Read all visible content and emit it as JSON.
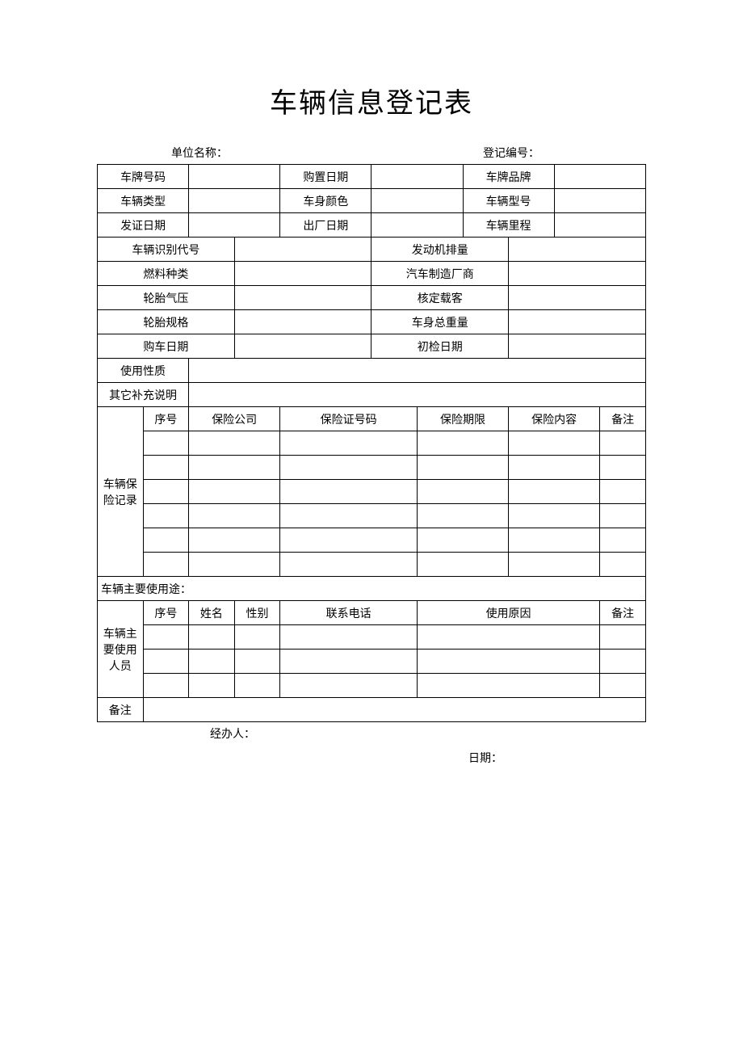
{
  "title": "车辆信息登记表",
  "header": {
    "unit_label": "单位名称：",
    "reg_no_label": "登记编号："
  },
  "rows3": [
    {
      "a": "车牌号码",
      "b": "购置日期",
      "c": "车牌品牌"
    },
    {
      "a": "车辆类型",
      "b": "车身颜色",
      "c": "车辆型号"
    },
    {
      "a": "发证日期",
      "b": "出厂日期",
      "c": "车辆里程"
    }
  ],
  "rows2": [
    {
      "a": "车辆识别代号",
      "b": "发动机排量"
    },
    {
      "a": "燃料种类",
      "b": "汽车制造厂商"
    },
    {
      "a": "轮胎气压",
      "b": "核定载客"
    },
    {
      "a": "轮胎规格",
      "b": "车身总重量"
    },
    {
      "a": "购车日期",
      "b": "初检日期"
    }
  ],
  "usage_nature_label": "使用性质",
  "other_notes_label": "其它补充说明",
  "insurance": {
    "section_label": "车辆保险记录",
    "headers": {
      "seq": "序号",
      "company": "保险公司",
      "cert_no": "保险证号码",
      "period": "保险期限",
      "content": "保险内容",
      "remark": "备注"
    }
  },
  "main_usage_label": "车辆主要使用途：",
  "users": {
    "section_label": "车辆主要使用人员",
    "headers": {
      "seq": "序号",
      "name": "姓名",
      "gender": "性别",
      "phone": "联系电话",
      "reason": "使用原因",
      "remark": "备注"
    }
  },
  "remark_label": "备注",
  "footer": {
    "handler_label": "经办人：",
    "date_label": "日期："
  }
}
